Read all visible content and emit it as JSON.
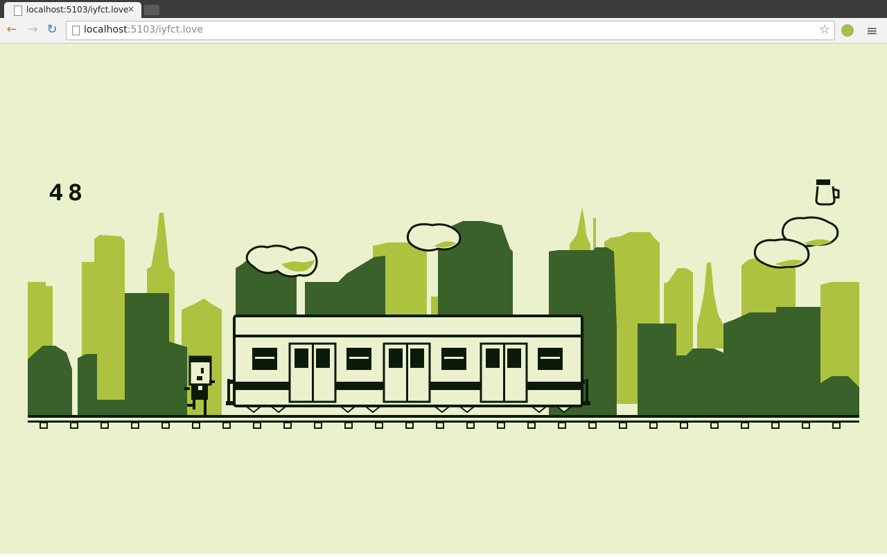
{
  "browser": {
    "tab_title": "localhost:5103/iyfct.love",
    "tab_close": "×",
    "url_host": "localhost",
    "url_rest": ":5103/iyfct.love",
    "icons": [
      "back-icon",
      "forward-icon",
      "reload-icon",
      "page-icon",
      "star-icon",
      "extension-icon",
      "menu-icon"
    ]
  },
  "game": {
    "score": "48",
    "palette": {
      "background": "#ebf1cd",
      "light": "#adc23f",
      "dark": "#3a612a",
      "ink": "#0b1a0a",
      "white": "#ebf1cd"
    }
  }
}
